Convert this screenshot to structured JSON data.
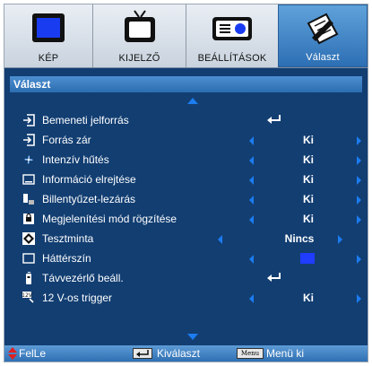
{
  "tabs": [
    {
      "label": "KÉP",
      "icon": "monitor-icon"
    },
    {
      "label": "KIJELZŐ",
      "icon": "tv-icon"
    },
    {
      "label": "BEÁLLÍTÁSOK",
      "icon": "projector-icon"
    },
    {
      "label": "Választ",
      "icon": "notepad-pencil-icon"
    }
  ],
  "header": {
    "title": "Választ"
  },
  "items": [
    {
      "label": "Bemeneti jelforrás",
      "value": "",
      "type": "enter",
      "icon": "input-source-icon"
    },
    {
      "label": "Forrás zár",
      "value": "Ki",
      "type": "select",
      "icon": "source-lock-icon"
    },
    {
      "label": "Intenzív hűtés",
      "value": "Ki",
      "type": "select",
      "icon": "fan-icon"
    },
    {
      "label": "Információ elrejtése",
      "value": "Ki",
      "type": "select",
      "icon": "info-hide-icon"
    },
    {
      "label": "Billentyűzet-lezárás",
      "value": "Ki",
      "type": "select",
      "icon": "keypad-lock-icon"
    },
    {
      "label": "Megjelenítési mód rögzítése",
      "value": "Ki",
      "type": "select",
      "icon": "display-mode-lock-icon"
    },
    {
      "label": "Tesztminta",
      "value": "Nincs",
      "type": "select",
      "icon": "test-pattern-icon"
    },
    {
      "label": "Háttérszín",
      "value": "",
      "type": "color",
      "icon": "background-color-icon"
    },
    {
      "label": "Távvezérlő beáll.",
      "value": "",
      "type": "enter",
      "icon": "remote-icon"
    },
    {
      "label": "12 V-os trigger",
      "value": "Ki",
      "type": "select",
      "icon": "trigger-12v-icon"
    }
  ],
  "colors": {
    "background": "#123e72",
    "accent": "#1c7cf0",
    "swatch": "#1f3cff"
  },
  "footer": {
    "updown_label": "FelLe",
    "select_label": "Kiválaszt",
    "menu_key": "Menu",
    "menu_label": "Menü ki"
  }
}
